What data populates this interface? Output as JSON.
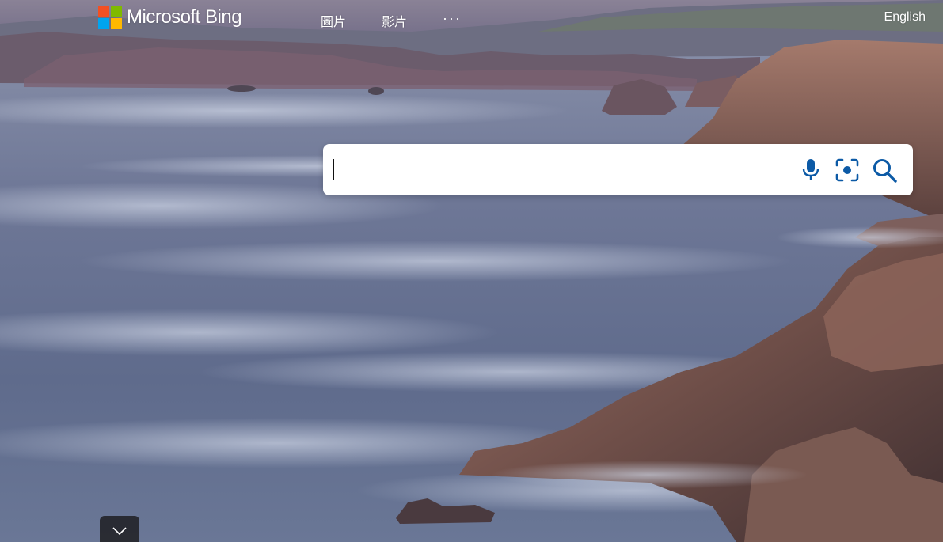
{
  "brand": {
    "name": "Microsoft Bing",
    "logo_colors": [
      "#f25022",
      "#7fba00",
      "#00a4ef",
      "#ffb900"
    ]
  },
  "nav": {
    "items": [
      {
        "label": "圖片"
      },
      {
        "label": "影片"
      }
    ],
    "more_label": "···"
  },
  "language_link": "English",
  "search": {
    "value": "",
    "placeholder": "",
    "accent_color": "#0c5aa6",
    "icons": [
      "microphone-icon",
      "visual-search-icon",
      "search-icon"
    ]
  },
  "scroll_down": {
    "icon": "chevron-down-icon"
  }
}
